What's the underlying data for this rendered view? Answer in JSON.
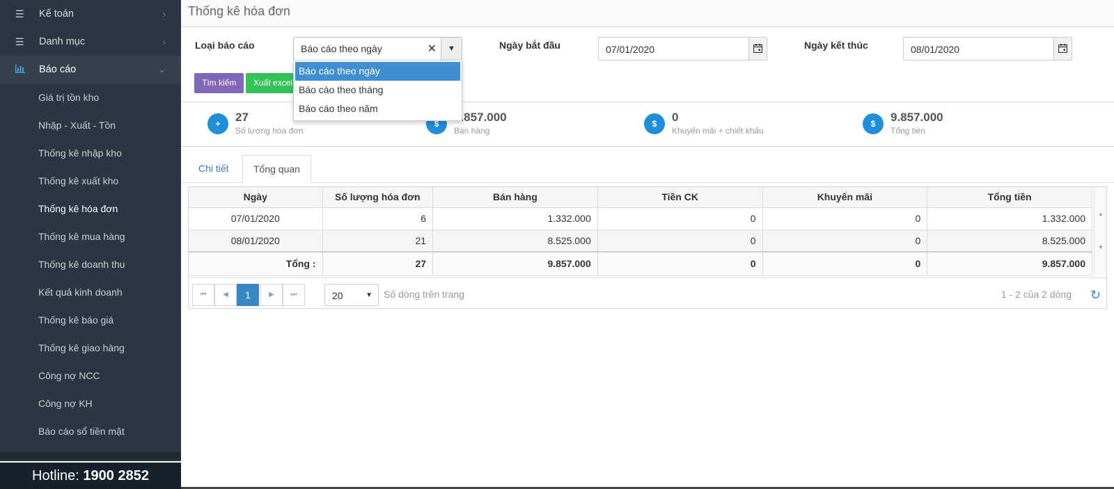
{
  "sidebar": {
    "items": [
      {
        "label": "Kế toán",
        "icon": "list-icon"
      },
      {
        "label": "Danh mục",
        "icon": "list-icon"
      },
      {
        "label": "Báo cáo",
        "icon": "bar-chart-icon"
      }
    ],
    "sub_items": [
      "Giá trị tồn kho",
      "Nhập - Xuất - Tồn",
      "Thống kê nhập kho",
      "Thống kê xuất kho",
      "Thống kê hóa đơn",
      "Thống kê mua hàng",
      "Thống kê doanh thu",
      "Kết quả kinh doanh",
      "Thống kê báo giá",
      "Thống kê giao hàng",
      "Công nợ NCC",
      "Công nợ KH",
      "Báo cáo sổ tiền mặt"
    ],
    "hotline_label": "Hotline:",
    "hotline_number": "1900 2852"
  },
  "page": {
    "title": "Thống kê hóa đơn"
  },
  "filters": {
    "report_type_label": "Loại báo cáo",
    "report_type_value": "Báo cáo theo ngày",
    "report_type_options": [
      "Báo cáo theo ngày",
      "Báo cáo theo tháng",
      "Báo cáo theo năm"
    ],
    "start_label": "Ngày bắt đầu",
    "start_value": "07/01/2020",
    "end_label": "Ngày kết thúc",
    "end_value": "08/01/2020",
    "search_button": "Tìm kiếm",
    "excel_button": "Xuất excel"
  },
  "stats": [
    {
      "value": "27",
      "label": "Số lượng hóa đơn",
      "icon": "plus-circle-icon"
    },
    {
      "value": "9.857.000",
      "label": "Bán hàng",
      "icon": "dollar-icon"
    },
    {
      "value": "0",
      "label": "Khuyến mãi + chiết khấu",
      "icon": "dollar-icon"
    },
    {
      "value": "9.857.000",
      "label": "Tổng tiền",
      "icon": "dollar-icon"
    }
  ],
  "tabs": [
    "Chi tiết",
    "Tổng quan"
  ],
  "table": {
    "headers": [
      "Ngày",
      "Số lượng hóa đơn",
      "Bán hàng",
      "Tiền CK",
      "Khuyến mãi",
      "Tổng tiền"
    ],
    "rows": [
      [
        "07/01/2020",
        "6",
        "1.332.000",
        "0",
        "0",
        "1.332.000"
      ],
      [
        "08/01/2020",
        "21",
        "8.525.000",
        "0",
        "0",
        "8.525.000"
      ]
    ],
    "footer": [
      "Tổng :",
      "27",
      "9.857.000",
      "0",
      "0",
      "9.857.000"
    ]
  },
  "pager": {
    "current_page": "1",
    "page_size": "20",
    "page_size_label": "Số dòng trên trang",
    "info": "1 - 2 của 2 dòng"
  }
}
